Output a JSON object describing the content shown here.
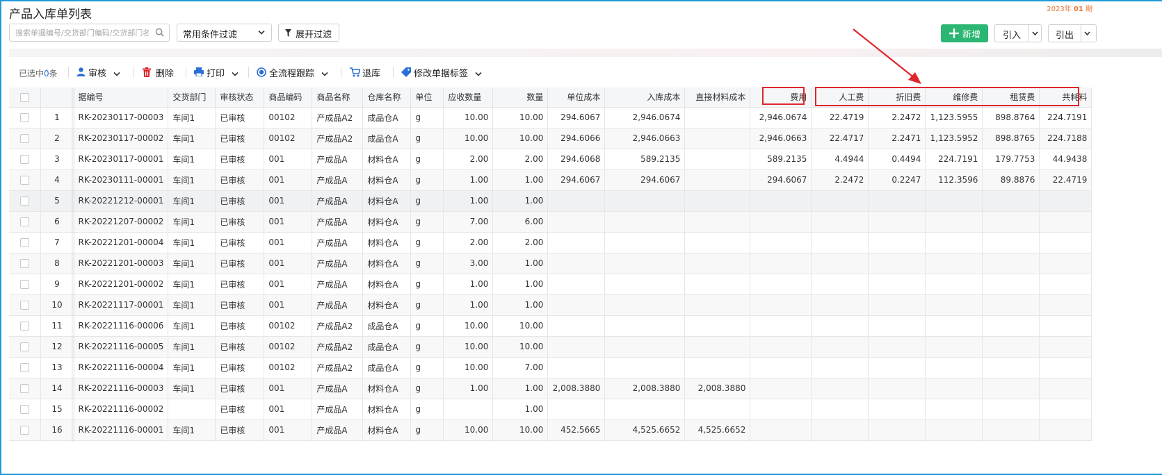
{
  "page": {
    "title": "产品入库单列表",
    "period_year": "2023年",
    "period_num": "01",
    "period_unit": "期"
  },
  "search": {
    "placeholder": "搜索单据编号/交货部门编码/交货部门名称"
  },
  "filter": {
    "common_label": "常用条件过滤",
    "expand_label": "展开过滤"
  },
  "actions": {
    "add_label": "新增",
    "import_label": "引入",
    "export_label": "引出"
  },
  "toolbar": {
    "selected_prefix": "已选中",
    "selected_count": "0",
    "selected_suffix": "条",
    "audit": "审核",
    "delete": "删除",
    "print": "打印",
    "trace": "全流程跟踪",
    "return": "退库",
    "tag": "修改单据标签"
  },
  "colors": {
    "accent": "#2bb673",
    "link": "#2a6fd6",
    "status_ok": "#48b84b",
    "annotation": "#e0252b"
  },
  "table": {
    "columns": [
      "",
      "",
      "据编号",
      "交货部门",
      "审核状态",
      "商品编码",
      "商品名称",
      "仓库名称",
      "单位",
      "应收数量",
      "数量",
      "单位成本",
      "入库成本",
      "直接材料成本",
      "费用",
      "人工费",
      "折旧费",
      "维修费",
      "租赁费",
      "共耗料"
    ],
    "rows": [
      {
        "n": "1",
        "no": "RK-20230117-00003",
        "dept": "车间1",
        "status": "已审核",
        "code": "00102",
        "name": "产成品A2",
        "wh": "成品仓A",
        "unit": "g",
        "due": "10.00",
        "qty": "10.00",
        "uc": "294.6067",
        "cost": "2,946.0674",
        "mat": "",
        "fee": "2,946.0674",
        "labor": "22.4719",
        "dep": "2.2472",
        "rep": "1,123.5955",
        "rent": "898.8764",
        "share": "224.7191"
      },
      {
        "n": "2",
        "no": "RK-20230117-00002",
        "dept": "车间1",
        "status": "已审核",
        "code": "00102",
        "name": "产成品A2",
        "wh": "成品仓A",
        "unit": "g",
        "due": "10.00",
        "qty": "10.00",
        "uc": "294.6066",
        "cost": "2,946.0663",
        "mat": "",
        "fee": "2,946.0663",
        "labor": "22.4717",
        "dep": "2.2471",
        "rep": "1,123.5952",
        "rent": "898.8765",
        "share": "224.7188"
      },
      {
        "n": "3",
        "no": "RK-20230117-00001",
        "dept": "车间1",
        "status": "已审核",
        "code": "001",
        "name": "产成品A",
        "wh": "材料仓A",
        "unit": "g",
        "due": "2.00",
        "qty": "2.00",
        "uc": "294.6068",
        "cost": "589.2135",
        "mat": "",
        "fee": "589.2135",
        "labor": "4.4944",
        "dep": "0.4494",
        "rep": "224.7191",
        "rent": "179.7753",
        "share": "44.9438"
      },
      {
        "n": "4",
        "no": "RK-20230111-00001",
        "dept": "车间1",
        "status": "已审核",
        "code": "001",
        "name": "产成品A",
        "wh": "材料仓A",
        "unit": "g",
        "due": "1.00",
        "qty": "1.00",
        "uc": "294.6067",
        "cost": "294.6067",
        "mat": "",
        "fee": "294.6067",
        "labor": "2.2472",
        "dep": "0.2247",
        "rep": "112.3596",
        "rent": "89.8876",
        "share": "22.4719"
      },
      {
        "n": "5",
        "no": "RK-20221212-00001",
        "dept": "车间1",
        "status": "已审核",
        "code": "001",
        "name": "产成品A",
        "wh": "材料仓A",
        "unit": "g",
        "due": "1.00",
        "qty": "1.00",
        "uc": "",
        "cost": "",
        "mat": "",
        "fee": "",
        "labor": "",
        "dep": "",
        "rep": "",
        "rent": "",
        "share": ""
      },
      {
        "n": "6",
        "no": "RK-20221207-00002",
        "dept": "车间1",
        "status": "已审核",
        "code": "001",
        "name": "产成品A",
        "wh": "材料仓A",
        "unit": "g",
        "due": "7.00",
        "qty": "6.00",
        "uc": "",
        "cost": "",
        "mat": "",
        "fee": "",
        "labor": "",
        "dep": "",
        "rep": "",
        "rent": "",
        "share": ""
      },
      {
        "n": "7",
        "no": "RK-20221201-00004",
        "dept": "车间1",
        "status": "已审核",
        "code": "001",
        "name": "产成品A",
        "wh": "材料仓A",
        "unit": "g",
        "due": "2.00",
        "qty": "2.00",
        "uc": "",
        "cost": "",
        "mat": "",
        "fee": "",
        "labor": "",
        "dep": "",
        "rep": "",
        "rent": "",
        "share": ""
      },
      {
        "n": "8",
        "no": "RK-20221201-00003",
        "dept": "车间1",
        "status": "已审核",
        "code": "001",
        "name": "产成品A",
        "wh": "材料仓A",
        "unit": "g",
        "due": "3.00",
        "qty": "1.00",
        "uc": "",
        "cost": "",
        "mat": "",
        "fee": "",
        "labor": "",
        "dep": "",
        "rep": "",
        "rent": "",
        "share": ""
      },
      {
        "n": "9",
        "no": "RK-20221201-00002",
        "dept": "车间1",
        "status": "已审核",
        "code": "001",
        "name": "产成品A",
        "wh": "材料仓A",
        "unit": "g",
        "due": "1.00",
        "qty": "1.00",
        "uc": "",
        "cost": "",
        "mat": "",
        "fee": "",
        "labor": "",
        "dep": "",
        "rep": "",
        "rent": "",
        "share": ""
      },
      {
        "n": "10",
        "no": "RK-20221117-00001",
        "dept": "车间1",
        "status": "已审核",
        "code": "001",
        "name": "产成品A",
        "wh": "材料仓A",
        "unit": "g",
        "due": "1.00",
        "qty": "1.00",
        "uc": "",
        "cost": "",
        "mat": "",
        "fee": "",
        "labor": "",
        "dep": "",
        "rep": "",
        "rent": "",
        "share": ""
      },
      {
        "n": "11",
        "no": "RK-20221116-00006",
        "dept": "车间1",
        "status": "已审核",
        "code": "00102",
        "name": "产成品A2",
        "wh": "成品仓A",
        "unit": "g",
        "due": "10.00",
        "qty": "10.00",
        "uc": "",
        "cost": "",
        "mat": "",
        "fee": "",
        "labor": "",
        "dep": "",
        "rep": "",
        "rent": "",
        "share": ""
      },
      {
        "n": "12",
        "no": "RK-20221116-00005",
        "dept": "车间1",
        "status": "已审核",
        "code": "00102",
        "name": "产成品A2",
        "wh": "成品仓A",
        "unit": "g",
        "due": "10.00",
        "qty": "10.00",
        "uc": "",
        "cost": "",
        "mat": "",
        "fee": "",
        "labor": "",
        "dep": "",
        "rep": "",
        "rent": "",
        "share": ""
      },
      {
        "n": "13",
        "no": "RK-20221116-00004",
        "dept": "车间1",
        "status": "已审核",
        "code": "00102",
        "name": "产成品A2",
        "wh": "成品仓A",
        "unit": "g",
        "due": "10.00",
        "qty": "7.00",
        "uc": "",
        "cost": "",
        "mat": "",
        "fee": "",
        "labor": "",
        "dep": "",
        "rep": "",
        "rent": "",
        "share": ""
      },
      {
        "n": "14",
        "no": "RK-20221116-00003",
        "dept": "车间1",
        "status": "已审核",
        "code": "001",
        "name": "产成品A",
        "wh": "材料仓A",
        "unit": "g",
        "due": "1.00",
        "qty": "1.00",
        "uc": "2,008.3880",
        "cost": "2,008.3880",
        "mat": "2,008.3880",
        "fee": "",
        "labor": "",
        "dep": "",
        "rep": "",
        "rent": "",
        "share": ""
      },
      {
        "n": "15",
        "no": "RK-20221116-00002",
        "dept": "",
        "status": "已审核",
        "code": "001",
        "name": "产成品A",
        "wh": "材料仓A",
        "unit": "g",
        "due": "",
        "qty": "1.00",
        "uc": "",
        "cost": "",
        "mat": "",
        "fee": "",
        "labor": "",
        "dep": "",
        "rep": "",
        "rent": "",
        "share": ""
      },
      {
        "n": "16",
        "no": "RK-20221116-00001",
        "dept": "车间1",
        "status": "已审核",
        "code": "001",
        "name": "产成品A",
        "wh": "材料仓A",
        "unit": "g",
        "due": "10.00",
        "qty": "10.00",
        "uc": "452.5665",
        "cost": "4,525.6652",
        "mat": "4,525.6652",
        "fee": "",
        "labor": "",
        "dep": "",
        "rep": "",
        "rent": "",
        "share": ""
      }
    ]
  }
}
